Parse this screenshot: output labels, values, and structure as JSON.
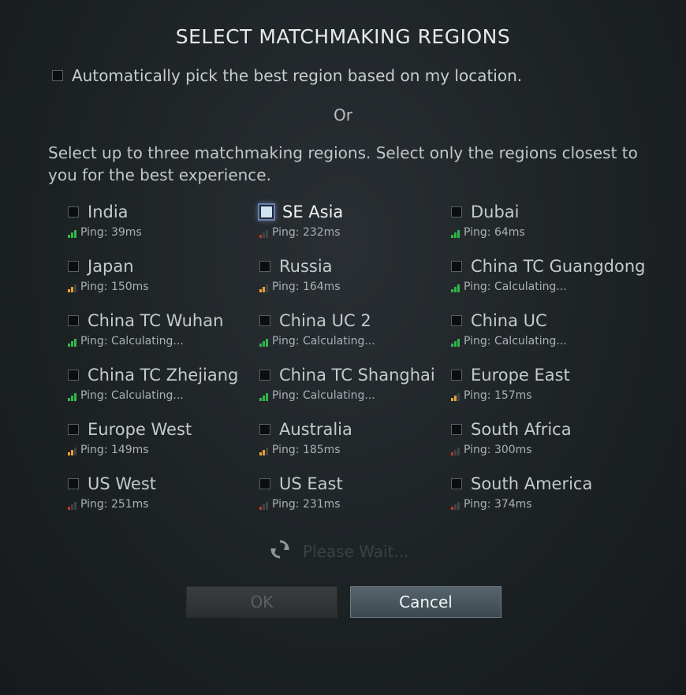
{
  "dialog": {
    "title": "SELECT MATCHMAKING REGIONS",
    "auto_pick_label": "Automatically pick the best region based on my location.",
    "or_label": "Or",
    "instructions": "Select up to three matchmaking regions. Select only the regions closest to you for the best experience.",
    "regions": [
      {
        "name": "India",
        "ping": "Ping: 39ms",
        "signal": "green"
      },
      {
        "name": "SE Asia",
        "ping": "Ping: 232ms",
        "signal": "red"
      },
      {
        "name": "Dubai",
        "ping": "Ping: 64ms",
        "signal": "green"
      },
      {
        "name": "Japan",
        "ping": "Ping: 150ms",
        "signal": "orange"
      },
      {
        "name": "Russia",
        "ping": "Ping: 164ms",
        "signal": "orange"
      },
      {
        "name": "China TC Guangdong",
        "ping": "Ping: Calculating...",
        "signal": "green"
      },
      {
        "name": "China TC Wuhan",
        "ping": "Ping: Calculating...",
        "signal": "green"
      },
      {
        "name": "China UC 2",
        "ping": "Ping: Calculating...",
        "signal": "green"
      },
      {
        "name": "China UC",
        "ping": "Ping: Calculating...",
        "signal": "green"
      },
      {
        "name": "China TC Zhejiang",
        "ping": "Ping: Calculating...",
        "signal": "green"
      },
      {
        "name": "China TC Shanghai",
        "ping": "Ping: Calculating...",
        "signal": "green"
      },
      {
        "name": "Europe East",
        "ping": "Ping: 157ms",
        "signal": "orange"
      },
      {
        "name": "Europe West",
        "ping": "Ping: 149ms",
        "signal": "orange"
      },
      {
        "name": "Australia",
        "ping": "Ping: 185ms",
        "signal": "orange"
      },
      {
        "name": "South Africa",
        "ping": "Ping: 300ms",
        "signal": "red"
      },
      {
        "name": "US West",
        "ping": "Ping: 251ms",
        "signal": "red"
      },
      {
        "name": "US East",
        "ping": "Ping: 231ms",
        "signal": "red"
      },
      {
        "name": "South America",
        "ping": "Ping: 374ms",
        "signal": "red"
      }
    ],
    "wait_icon": "refresh-icon",
    "wait_label": "Please Wait...",
    "ok_label": "OK",
    "cancel_label": "Cancel"
  },
  "colors": {
    "signal_green": "#2fb84a",
    "signal_orange": "#e8a231",
    "signal_red": "#c0392b",
    "signal_off": "#3e4448",
    "cancel_bg": "#4a5760",
    "ok_disabled_bg": "#333638"
  }
}
